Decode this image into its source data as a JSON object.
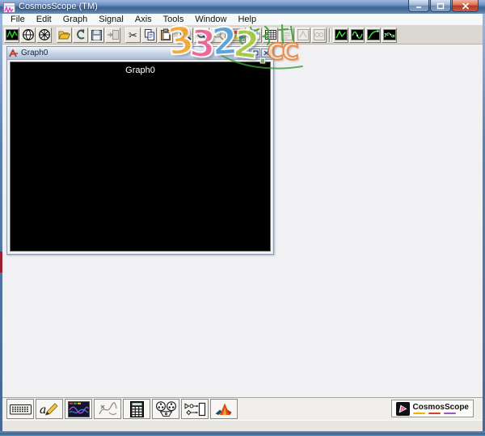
{
  "window": {
    "title": "CosmosScope (TM)",
    "controls": {
      "minimize": "minimize",
      "maximize": "maximize",
      "close": "close"
    }
  },
  "menu": {
    "items": [
      "File",
      "Edit",
      "Graph",
      "Signal",
      "Axis",
      "Tools",
      "Window",
      "Help"
    ]
  },
  "toolbar": {
    "buttons": [
      "xy-graph",
      "smith-chart",
      "polar-chart",
      "open",
      "undo",
      "save",
      "import-disabled",
      "cut",
      "copy",
      "paste",
      "zoom-in",
      "zoom-out",
      "zoom-full-disabled",
      "tile-windows",
      "cascade-windows",
      "grid",
      "obscured-tool-1",
      "obscured-tool-2",
      "obscured-tool-3",
      "waveform-style-1",
      "waveform-style-2",
      "waveform-style-3",
      "waveform-style-4"
    ]
  },
  "graph_window": {
    "title": "Graph0",
    "canvas_label": "Graph0"
  },
  "watermark": {
    "digits": [
      "3",
      "3",
      "2",
      "2"
    ],
    "dot": ".",
    "suffix": "CC",
    "colors": {
      "digit1": "#f6a528",
      "digit2": "#ef5f8e",
      "digit3": "#4f9ed9",
      "digit4": "#a8c93f",
      "dot": "#6fae3a",
      "suffix_outline": "#e8823c",
      "scribble": "#3aa03a"
    }
  },
  "bottom_toolbar": {
    "tools": [
      "keyboard",
      "annotation",
      "waveform-viewer",
      "probe",
      "calculator",
      "tape-recorder",
      "signal-flow",
      "matlab"
    ]
  },
  "badge": {
    "label": "CosmosScope",
    "underline_colors": [
      "#f0b400",
      "#d44028",
      "#9a5ac8"
    ]
  },
  "icons": {
    "app-icon": "window-with-magenta-waveform",
    "minimize-icon": "–",
    "maximize-icon": "▢",
    "close-icon": "✕",
    "cut-icon": "✂",
    "graph-window-icon": "red-italic-brand-mark",
    "cosmos-logo-icon": "triangle-in-black-square",
    "matlab-icon": "matlab-membrane-logo"
  },
  "colors": {
    "titlebar_blue": "#4a71a8",
    "menu_bg": "#f6f8fa",
    "toolbar_bg": "#dbd8d1",
    "mdi_bg": "#f1f0f3",
    "canvas_bg": "#000000",
    "close_red": "#b03a28"
  }
}
